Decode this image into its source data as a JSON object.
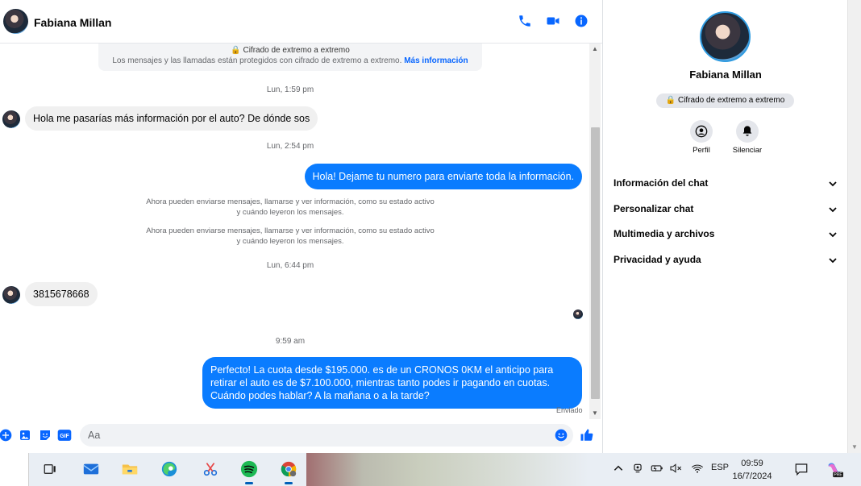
{
  "header": {
    "contact_name": "Fabiana Millan"
  },
  "conversation": {
    "e2e_title": "Cifrado de extremo a extremo",
    "e2e_desc": "Los mensajes y las llamadas están protegidos con cifrado de extremo a extremo.",
    "e2e_link": "Más información",
    "timestamps": [
      "Lun, 1:59 pm",
      "Lun, 2:54 pm",
      "Lun, 6:44 pm",
      "9:59 am"
    ],
    "messages": [
      {
        "from": "them",
        "text": "Hola me pasarías más información por el auto? De dónde sos"
      },
      {
        "from": "me",
        "text": "Hola! Dejame tu numero  para enviarte toda la información."
      },
      {
        "from": "them",
        "text": "3815678668"
      },
      {
        "from": "me",
        "text": "Perfecto! La cuota desde $195.000. es de un CRONOS 0KM el anticipo para retirar el auto es de $7.100.000, mientras tanto podes ir pagando en cuotas. Cuándo podes hablar? A la mañana o a la tarde?"
      }
    ],
    "system_notices": [
      "Ahora pueden enviarse mensajes, llamarse y ver información, como su estado activo y cuándo leyeron los mensajes.",
      "Ahora pueden enviarse mensajes, llamarse y ver información, como su estado activo y cuándo leyeron los mensajes."
    ],
    "sent_status": "Enviado"
  },
  "composer": {
    "placeholder": "Aa"
  },
  "panel": {
    "name": "Fabiana Millan",
    "e2e_pill": "Cifrado de extremo a extremo",
    "profile_label": "Perfil",
    "mute_label": "Silenciar",
    "sections": [
      {
        "label": "Información del chat"
      },
      {
        "label": "Personalizar chat"
      },
      {
        "label": "Multimedia y archivos"
      },
      {
        "label": "Privacidad y ayuda"
      }
    ]
  },
  "taskbar": {
    "language": "ESP",
    "time": "09:59",
    "date": "16/7/2024",
    "badge": "PRE",
    "apps": [
      "task-view",
      "mail",
      "file-explorer",
      "edge",
      "snipping-tool",
      "spotify",
      "chrome"
    ]
  },
  "colors": {
    "accent": "#0a7cff",
    "messenger_blue": "#0866ff",
    "bubble_in": "#f0f0f0"
  }
}
